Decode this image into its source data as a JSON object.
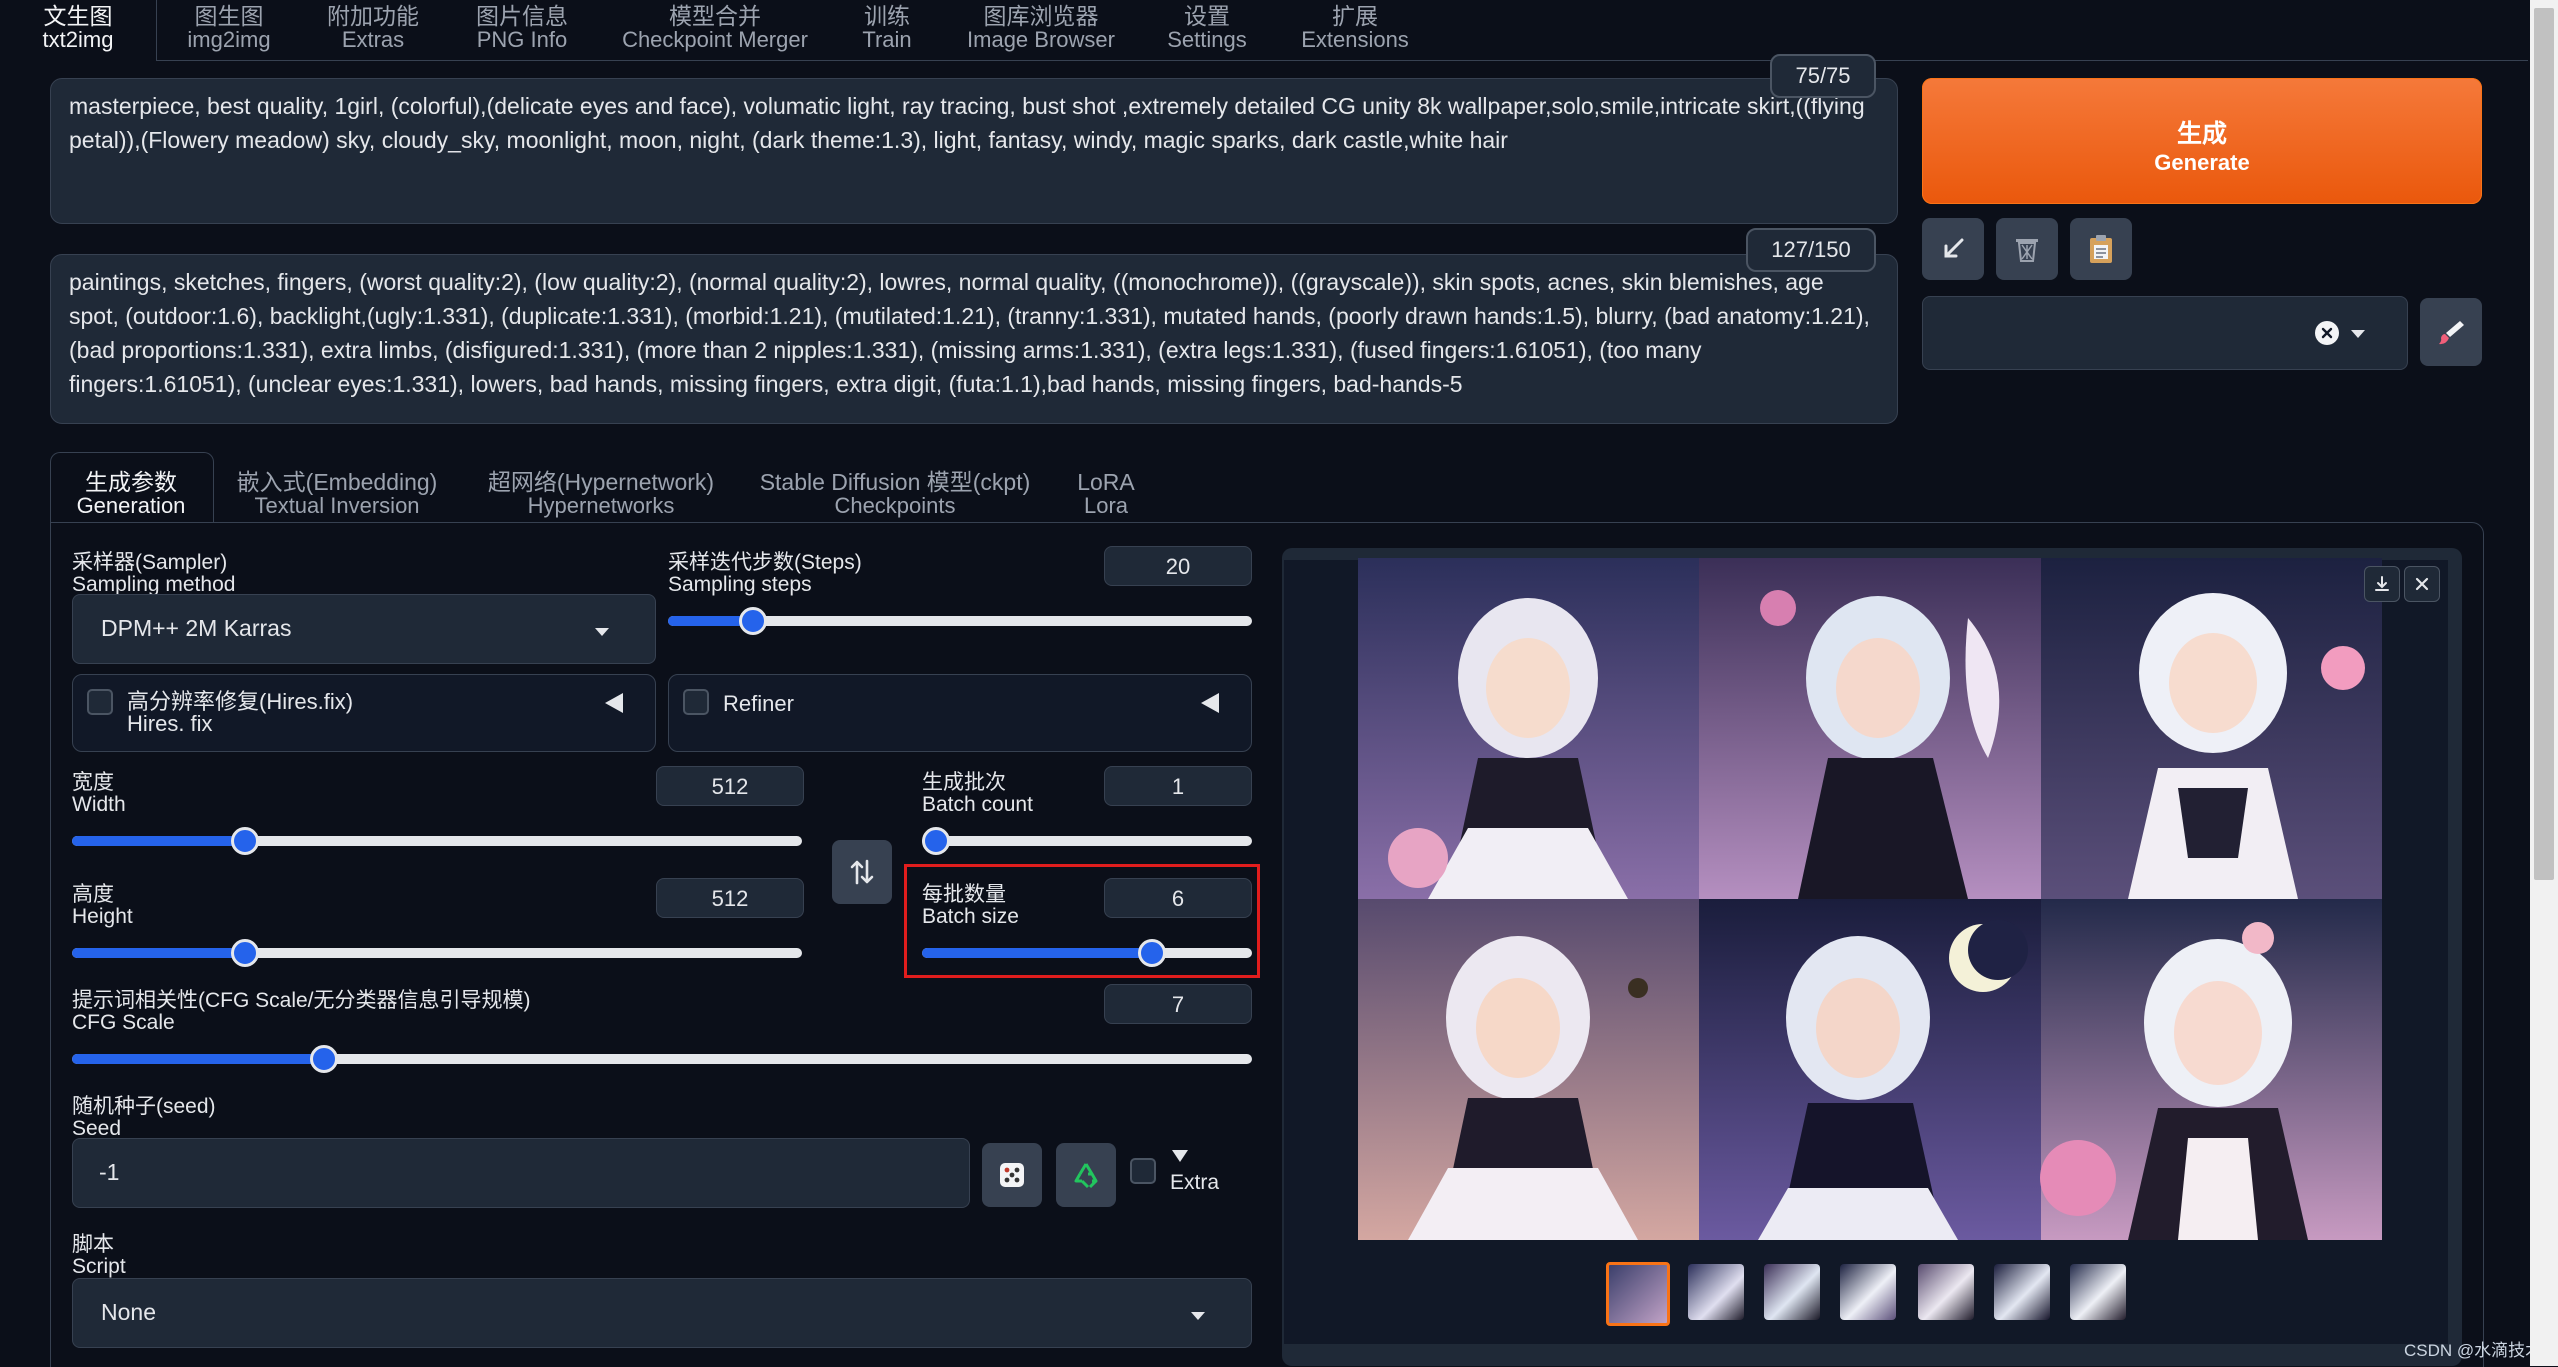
{
  "top_tabs": [
    {
      "zh": "文生图",
      "en": "txt2img"
    },
    {
      "zh": "图生图",
      "en": "img2img"
    },
    {
      "zh": "附加功能",
      "en": "Extras"
    },
    {
      "zh": "图片信息",
      "en": "PNG Info"
    },
    {
      "zh": "模型合并",
      "en": "Checkpoint Merger"
    },
    {
      "zh": "训练",
      "en": "Train"
    },
    {
      "zh": "图库浏览器",
      "en": "Image Browser"
    },
    {
      "zh": "设置",
      "en": "Settings"
    },
    {
      "zh": "扩展",
      "en": "Extensions"
    }
  ],
  "prompt": {
    "text": "masterpiece, best quality, 1girl, (colorful),(delicate eyes and face), volumatic light, ray tracing, bust shot ,extremely detailed CG unity 8k wallpaper,solo,smile,intricate skirt,((flying petal)),(Flowery meadow) sky, cloudy_sky, moonlight, moon, night, (dark theme:1.3), light, fantasy, windy, magic sparks, dark castle,white hair",
    "counter": "75/75"
  },
  "negative_prompt": {
    "text": "paintings, sketches, fingers, (worst quality:2), (low quality:2), (normal quality:2), lowres, normal quality, ((monochrome)), ((grayscale)), skin spots, acnes, skin blemishes, age spot, (outdoor:1.6), backlight,(ugly:1.331), (duplicate:1.331), (morbid:1.21), (mutilated:1.21), (tranny:1.331), mutated hands, (poorly drawn hands:1.5), blurry, (bad anatomy:1.21), (bad proportions:1.331), extra limbs, (disfigured:1.331), (more than 2 nipples:1.331), (missing arms:1.331), (extra legs:1.331), (fused fingers:1.61051), (too many fingers:1.61051), (unclear eyes:1.331), lowers, bad hands, missing fingers, extra digit, (futa:1.1),bad hands, missing fingers, bad-hands-5",
    "counter": "127/150"
  },
  "generate": {
    "zh": "生成",
    "en": "Generate"
  },
  "sub_tabs": [
    {
      "zh": "生成参数",
      "en": "Generation"
    },
    {
      "zh": "嵌入式(Embedding)",
      "en": "Textual Inversion"
    },
    {
      "zh": "超网络(Hypernetwork)",
      "en": "Hypernetworks"
    },
    {
      "zh": "Stable Diffusion 模型(ckpt)",
      "en": "Checkpoints"
    },
    {
      "zh": "LoRA",
      "en": "Lora"
    }
  ],
  "sampler": {
    "zh": "采样器(Sampler)",
    "en": "Sampling method",
    "value": "DPM++ 2M Karras"
  },
  "steps": {
    "zh": "采样迭代步数(Steps)",
    "en": "Sampling steps",
    "value": "20",
    "min": 1,
    "max": 150,
    "level": 20
  },
  "hires": {
    "zh": "高分辨率修复(Hires.fix)",
    "en": "Hires. fix"
  },
  "refiner": {
    "label": "Refiner"
  },
  "width": {
    "zh": "宽度",
    "en": "Width",
    "value": "512",
    "min": 64,
    "max": 2048,
    "level": 512
  },
  "height": {
    "zh": "高度",
    "en": "Height",
    "value": "512",
    "min": 64,
    "max": 2048,
    "level": 512
  },
  "batch_count": {
    "zh": "生成批次",
    "en": "Batch count",
    "value": "1",
    "min": 1,
    "max": 100,
    "level": 1
  },
  "batch_size": {
    "zh": "每批数量",
    "en": "Batch size",
    "value": "6",
    "min": 1,
    "max": 8,
    "level": 6
  },
  "cfg": {
    "zh": "提示词相关性(CFG Scale/无分类器信息引导规模)",
    "en": "CFG Scale",
    "value": "7",
    "min": 1,
    "max": 30,
    "level": 7
  },
  "seed": {
    "zh": "随机种子(seed)",
    "en": "Seed",
    "value": "-1",
    "extra_label": "Extra"
  },
  "script": {
    "zh": "脚本",
    "en": "Script",
    "value": "None"
  },
  "watermark": "CSDN @水滴技术",
  "colors": {
    "accent": "#2563eb",
    "generate": "#ea580c",
    "highlight": "#e11d1d",
    "background": "#0b0f19",
    "panel": "#1f2937"
  }
}
